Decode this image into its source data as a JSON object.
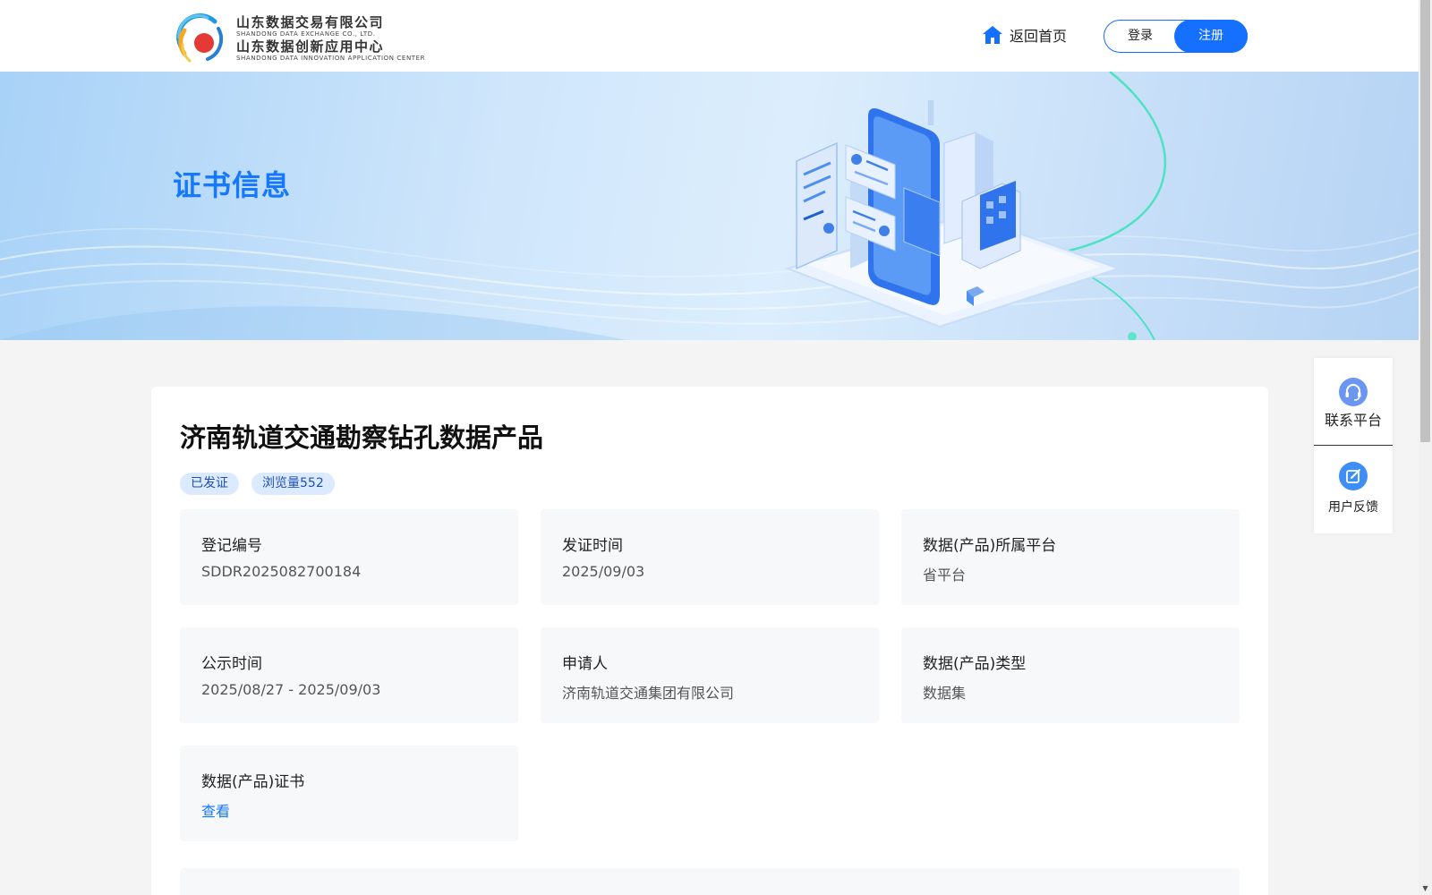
{
  "header": {
    "logo": {
      "company_cn": "山东数据交易有限公司",
      "company_en": "SHANDONG DATA EXCHANGE CO., LTD.",
      "center_cn": "山东数据创新应用中心",
      "center_en": "SHANDONG DATA INNOVATION APPLICATION CENTER"
    },
    "home_link": "返回首页",
    "login": "登录",
    "register": "注册"
  },
  "banner": {
    "title": "证书信息"
  },
  "product": {
    "title": "济南轨道交通勘察钻孔数据产品",
    "tags": [
      "已发证",
      "浏览量552"
    ],
    "fields": [
      {
        "label": "登记编号",
        "value": "SDDR2025082700184"
      },
      {
        "label": "发证时间",
        "value": "2025/09/03"
      },
      {
        "label": "数据(产品)所属平台",
        "value": "省平台"
      },
      {
        "label": "公示时间",
        "value": "2025/08/27 - 2025/09/03"
      },
      {
        "label": "申请人",
        "value": "济南轨道交通集团有限公司"
      },
      {
        "label": "数据(产品)类型",
        "value": "数据集"
      },
      {
        "label": "数据(产品)证书",
        "value": "查看"
      }
    ]
  },
  "side_panel": {
    "contact": "联系平台",
    "feedback": "用户反馈"
  },
  "colors": {
    "brand_blue": "#1677ff",
    "button_blue": "#1570ff",
    "tag_bg": "#dbeafe",
    "tag_text": "#1f4fb8",
    "page_bg": "#f4f4f4"
  }
}
